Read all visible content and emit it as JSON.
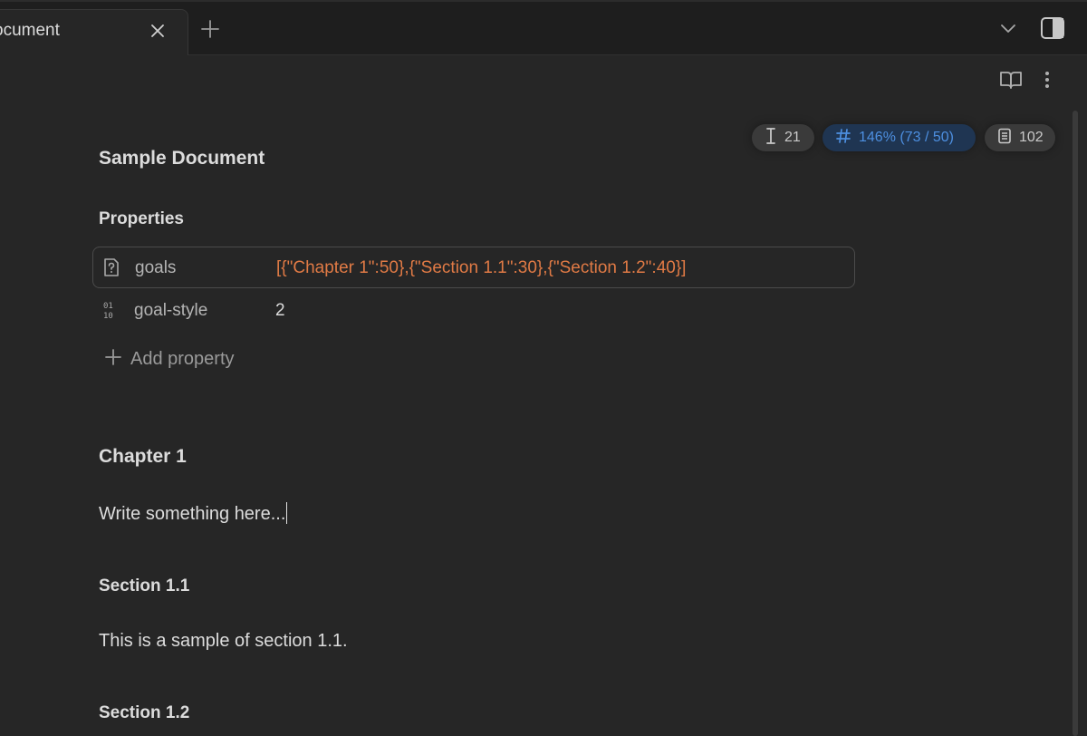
{
  "tab": {
    "title": "ocument"
  },
  "status": {
    "words": "21",
    "goal": "146% (73 / 50)",
    "pages": "102"
  },
  "document": {
    "title": "Sample Document",
    "properties_heading": "Properties",
    "properties": [
      {
        "icon": "unknown-type-icon",
        "key": "goals",
        "value": "[{\"Chapter 1\":50},{\"Section 1.1\":30},{\"Section 1.2\":40}]"
      },
      {
        "icon": "number-type-icon",
        "key": "goal-style",
        "value": "2"
      }
    ],
    "add_property": "Add property",
    "chapter_heading": "Chapter 1",
    "chapter_text": "Write something here...",
    "section1_heading": "Section 1.1",
    "section1_text": "This is a sample of section 1.1.",
    "section2_heading": "Section 1.2"
  },
  "colors": {
    "background": "#262626",
    "tabbar": "#1e1e1e",
    "property_value": "#e07a45",
    "goal_pill_text": "#4d8fe0",
    "goal_pill_bg": "#1f3552"
  }
}
